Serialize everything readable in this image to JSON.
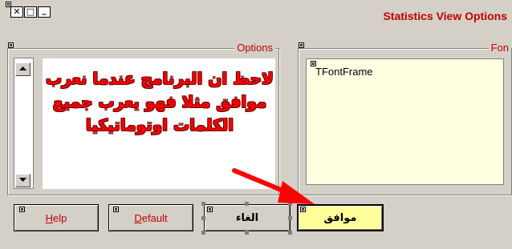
{
  "window": {
    "title": "Statistics View Options",
    "controls": {
      "close": "✕",
      "maximize": "□",
      "minimize": "_"
    }
  },
  "options_group": {
    "caption": "Options",
    "overlay_text": "لاحظ ان البرنامج عندما نعرب موافق مثلا فهو يعرب جميع الكلمات اوتوماتيكيا"
  },
  "font_group": {
    "caption": "Fon",
    "frame_label": "TFontFrame"
  },
  "buttons": {
    "help": {
      "mnemonic": "H",
      "rest": "elp"
    },
    "default": {
      "mnemonic": "D",
      "rest": "efault"
    },
    "cancel": "الغاء",
    "ok": "موافق"
  },
  "colors": {
    "title": "#c00000",
    "annotation": "#ff0000",
    "ok_button": "#ffff9a",
    "font_frame": "#ffffe1",
    "window": "#d4d0c8"
  }
}
